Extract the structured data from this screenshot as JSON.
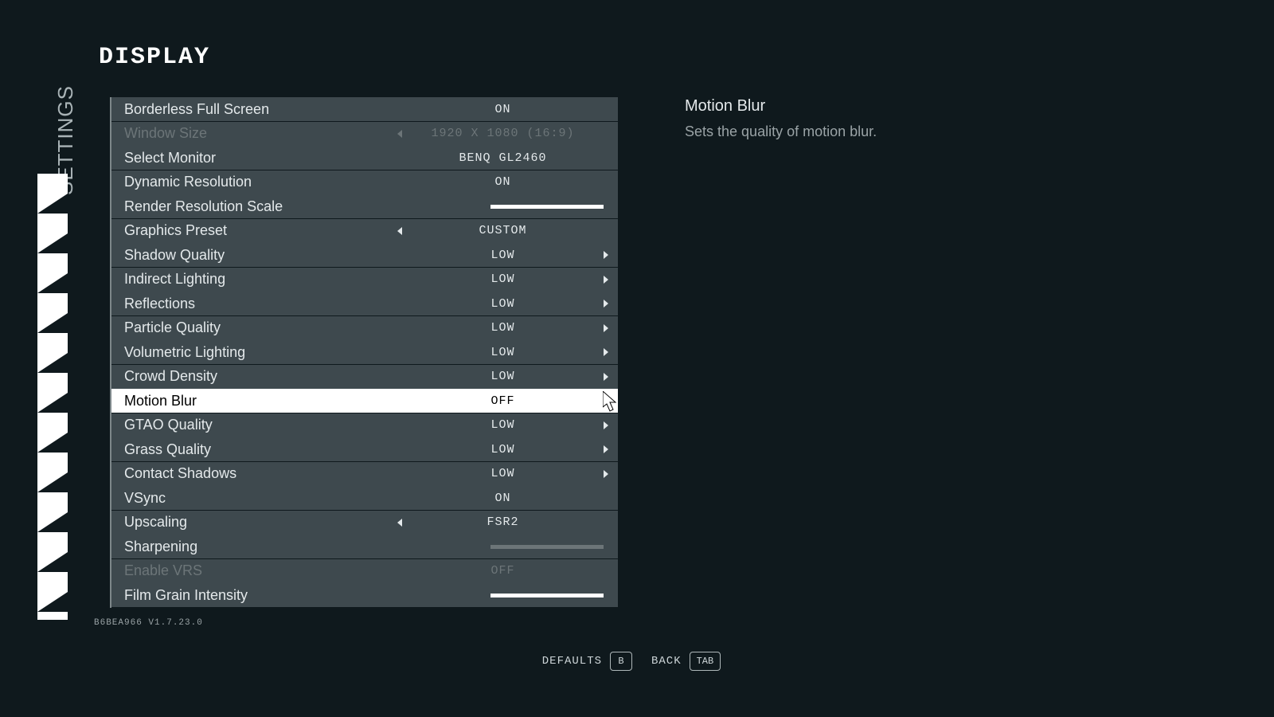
{
  "vertical_label": "SETTINGS",
  "page_title": "DISPLAY",
  "description": {
    "title": "Motion Blur",
    "text": "Sets the quality of motion blur."
  },
  "version": "B6BEA966 V1.7.23.0",
  "footer": {
    "defaults_label": "DEFAULTS",
    "defaults_key": "B",
    "back_label": "BACK",
    "back_key": "TAB"
  },
  "rows": [
    {
      "label": "Borderless Full Screen",
      "type": "value",
      "value": "ON"
    },
    {
      "label": "Window Size",
      "type": "spinner",
      "value": "1920 X 1080 (16:9)",
      "left": true,
      "disabled": true
    },
    {
      "label": "Select Monitor",
      "type": "value",
      "value": "BENQ GL2460"
    },
    {
      "label": "Dynamic Resolution",
      "type": "value",
      "value": "ON"
    },
    {
      "label": "Render Resolution Scale",
      "type": "slider",
      "fill": 100
    },
    {
      "label": "Graphics Preset",
      "type": "spinner",
      "value": "CUSTOM",
      "left": true
    },
    {
      "label": "Shadow Quality",
      "type": "spinner",
      "value": "LOW",
      "right": true
    },
    {
      "label": "Indirect Lighting",
      "type": "spinner",
      "value": "LOW",
      "right": true
    },
    {
      "label": "Reflections",
      "type": "spinner",
      "value": "LOW",
      "right": true
    },
    {
      "label": "Particle Quality",
      "type": "spinner",
      "value": "LOW",
      "right": true
    },
    {
      "label": "Volumetric Lighting",
      "type": "spinner",
      "value": "LOW",
      "right": true
    },
    {
      "label": "Crowd Density",
      "type": "spinner",
      "value": "LOW",
      "right": true
    },
    {
      "label": "Motion Blur",
      "type": "spinner",
      "value": "OFF",
      "right": true,
      "selected": true
    },
    {
      "label": "GTAO Quality",
      "type": "spinner",
      "value": "LOW",
      "right": true
    },
    {
      "label": "Grass Quality",
      "type": "spinner",
      "value": "LOW",
      "right": true
    },
    {
      "label": "Contact Shadows",
      "type": "spinner",
      "value": "LOW",
      "right": true
    },
    {
      "label": "VSync",
      "type": "value",
      "value": "ON"
    },
    {
      "label": "Upscaling",
      "type": "spinner",
      "value": "FSR2",
      "left": true
    },
    {
      "label": "Sharpening",
      "type": "slider",
      "fill": 0,
      "slider_disabled": true
    },
    {
      "label": "Enable VRS",
      "type": "value",
      "value": "OFF",
      "disabled": true
    },
    {
      "label": "Film Grain Intensity",
      "type": "slider",
      "fill": 100
    }
  ]
}
